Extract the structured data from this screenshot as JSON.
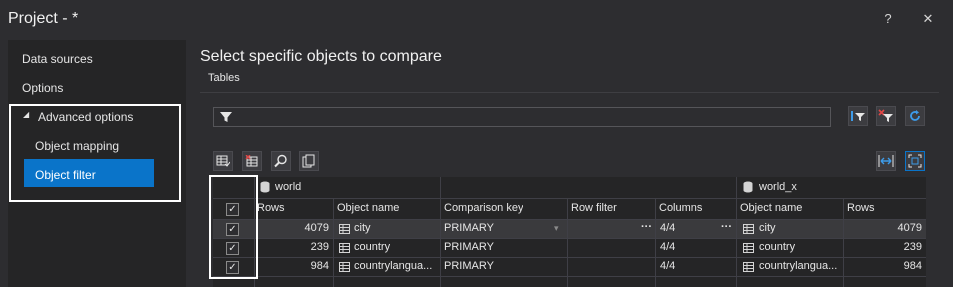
{
  "window": {
    "title": "Project - *",
    "help": "?",
    "close": "✕"
  },
  "nav": {
    "items": [
      "Data sources",
      "Options"
    ],
    "advanced": "Advanced options",
    "advanced_arrow": "◢",
    "subitems": [
      "Object mapping",
      "Object filter"
    ]
  },
  "main": {
    "heading": "Select specific objects to compare",
    "tab": "Tables"
  },
  "grid": {
    "left_db": "world",
    "right_db": "world_x",
    "headers": [
      "Rows",
      "Object name",
      "Comparison key",
      "Row filter",
      "Columns",
      "Object name",
      "Rows"
    ],
    "rows": [
      {
        "checked": "✓",
        "rows": "4079",
        "name": "city",
        "key": "PRIMARY",
        "columns": "4/4",
        "rname": "city",
        "rrows": "4079"
      },
      {
        "checked": "✓",
        "rows": "239",
        "name": "country",
        "key": "PRIMARY",
        "columns": "4/4",
        "rname": "country",
        "rrows": "239"
      },
      {
        "checked": "✓",
        "rows": "984",
        "name": "countrylangua...",
        "key": "PRIMARY",
        "columns": "4/4",
        "rname": "countrylangua...",
        "rrows": "984"
      }
    ],
    "ellipsis": "···",
    "dropdown": "▾",
    "header_check": "✓"
  },
  "colors": {
    "accent": "#0a74c9",
    "highlight_border": "#ffffff",
    "icon_blue": "#3d9be9",
    "icon_red": "#e04545"
  }
}
